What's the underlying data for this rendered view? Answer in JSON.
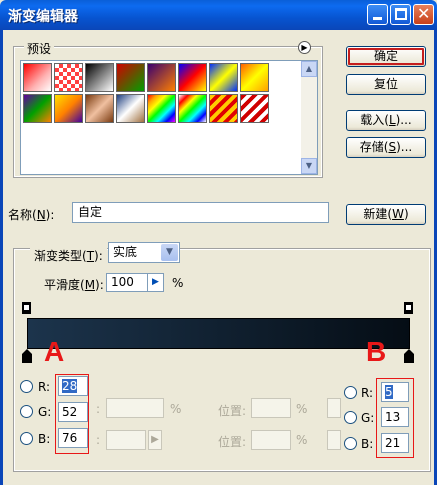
{
  "window": {
    "title": "渐变编辑器",
    "controls": {
      "minimize_icon": "minimize-icon",
      "maximize_icon": "maximize-icon",
      "close_icon": "close-icon",
      "close_glyph": "✕"
    }
  },
  "presets": {
    "label": "预设",
    "menu_glyph": "▶",
    "swatches": [
      {
        "name": "red-transparent",
        "css": "linear-gradient(135deg,#ff0000,#ffb0b0 60%,#fff)"
      },
      {
        "name": "red-checker",
        "css": "repeating-conic-gradient(#ff4040 0 25%, #ffffff 0 50%) 0 0/8px 8px"
      },
      {
        "name": "black-white",
        "css": "linear-gradient(135deg,#000,#fff)"
      },
      {
        "name": "red-green",
        "css": "linear-gradient(135deg,#d00000,#00a000)"
      },
      {
        "name": "violet-orange",
        "css": "linear-gradient(135deg,#3a0070,#ff8000)"
      },
      {
        "name": "blue-red-yellow",
        "css": "linear-gradient(135deg,#0000ff,#ff0000,#ffff00)"
      },
      {
        "name": "blue-yellow-blue",
        "css": "linear-gradient(135deg,#0030ff,#ffff00,#0030ff)"
      },
      {
        "name": "orange-yellow",
        "css": "linear-gradient(135deg,#ff6000,#ffff00,#ffa000)"
      },
      {
        "name": "violet-green-orange",
        "css": "linear-gradient(135deg,#6000a0,#00a000,#ff8000)"
      },
      {
        "name": "yellow-violet",
        "css": "linear-gradient(135deg,#ffe000,#ff8000,#4000a0)"
      },
      {
        "name": "copper",
        "css": "linear-gradient(135deg,#7a3a10,#f0c0a0,#7a3a10)"
      },
      {
        "name": "chrome",
        "css": "linear-gradient(135deg,#204080,#ffffff,#a07040)"
      },
      {
        "name": "spectrum",
        "css": "linear-gradient(135deg,red,orange,yellow,lime,cyan,blue,magenta)"
      },
      {
        "name": "transparent-rainbow",
        "css": "linear-gradient(135deg,#fff0,red,yellow,lime,cyan,blue,#fff)"
      },
      {
        "name": "yellow-red-stripes",
        "css": "repeating-linear-gradient(135deg,#ffcc00 0 4px,#e00000 4px 8px)"
      },
      {
        "name": "red-white-stripes",
        "css": "repeating-linear-gradient(135deg,#d00000 0 4px,#ffffff 4px 8px)"
      }
    ],
    "scroll_up_glyph": "▲",
    "scroll_down_glyph": "▼"
  },
  "buttons": {
    "ok": "确定",
    "reset": "复位",
    "load": {
      "label": "载入(",
      "key": "L",
      "suffix": ")..."
    },
    "save": {
      "label": "存储(",
      "key": "S",
      "suffix": ")..."
    },
    "new": {
      "label": "新建(",
      "key": "W",
      "suffix": ")"
    }
  },
  "name_field": {
    "label_prefix": "名称(",
    "label_key": "N",
    "label_suffix": "):",
    "value": "自定"
  },
  "gradient": {
    "type_label_prefix": "渐变类型(",
    "type_key": "T",
    "type_suffix": "):",
    "type_value": "实底",
    "smooth_label_prefix": "平滑度(",
    "smooth_key": "M",
    "smooth_suffix": "):",
    "smooth_value": "100",
    "smooth_unit": "%",
    "start_color": "#1c344c",
    "end_color": "#050d15"
  },
  "annotations": {
    "left_letter": "A",
    "right_letter": "B",
    "accent_color": "#e81818"
  },
  "color_left": {
    "r_label": "R:",
    "r_value": "28",
    "g_label": "G:",
    "g_value": "52",
    "b_label": "B:",
    "b_value": "76"
  },
  "color_right": {
    "r_label": "R:",
    "r_value": "5",
    "g_label": "G:",
    "g_value": "13",
    "b_label": "B:",
    "b_value": "21"
  },
  "disabled_fields": {
    "colon": ":",
    "percent": "%",
    "position_label": "位置:",
    "arrow_glyph": "▶"
  }
}
